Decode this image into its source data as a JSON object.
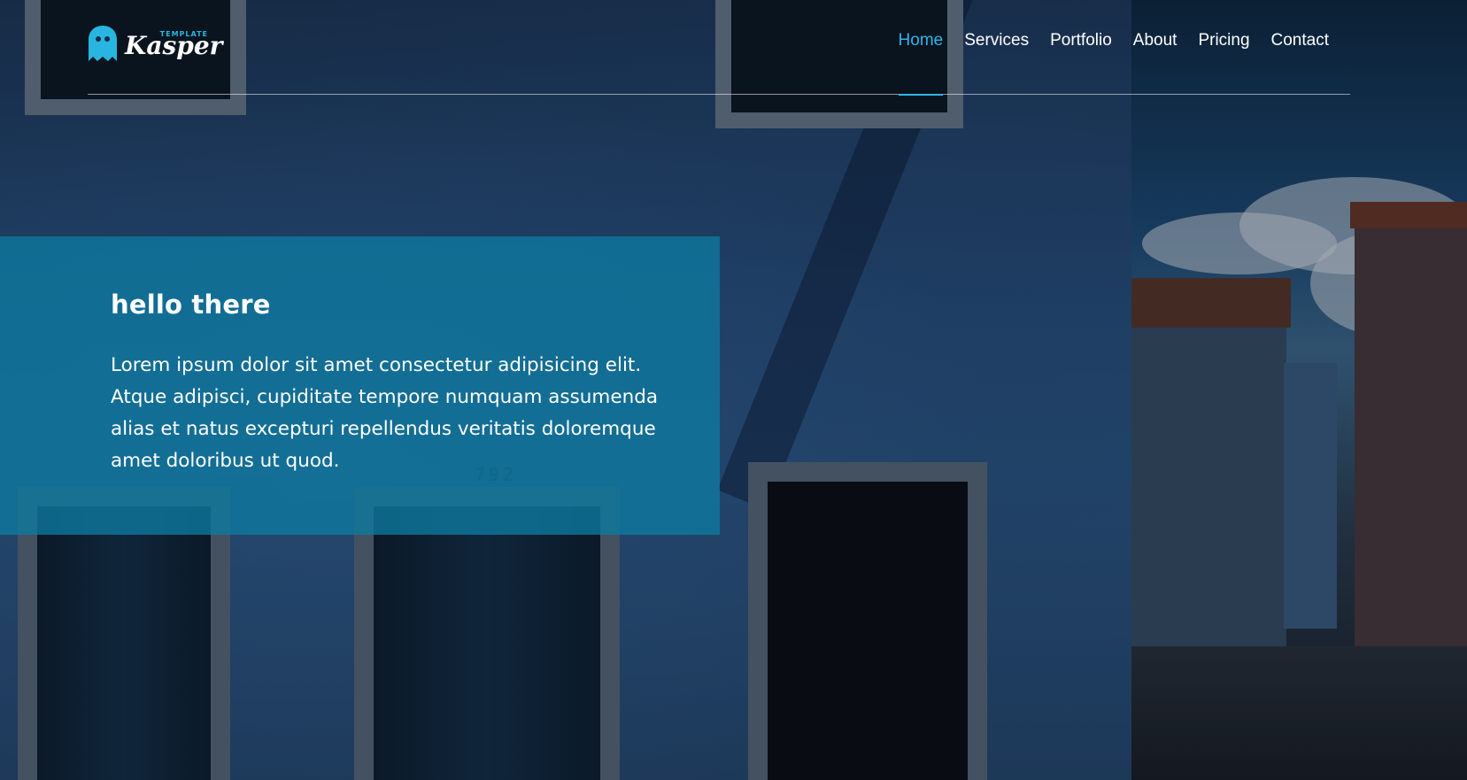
{
  "brand": {
    "name": "Kasper",
    "tagline": "TEMPLATE",
    "icon": "ghost-icon",
    "accent_color": "#2fb6ea"
  },
  "nav": {
    "items": [
      {
        "label": "Home",
        "active": true
      },
      {
        "label": "Services",
        "active": false
      },
      {
        "label": "Portfolio",
        "active": false
      },
      {
        "label": "About",
        "active": false
      },
      {
        "label": "Pricing",
        "active": false
      },
      {
        "label": "Contact",
        "active": false
      }
    ]
  },
  "hero": {
    "title": "hello there",
    "body": "Lorem ipsum dolor sit amet consectetur adipisicing elit. Atque adipisci, cupiditate tempore numquam assumenda alias et natus excepturi repellendus veritatis doloremque amet doloribus ut quod.",
    "box_color": "#0e7aa0"
  },
  "background": {
    "wall_number": "792"
  }
}
